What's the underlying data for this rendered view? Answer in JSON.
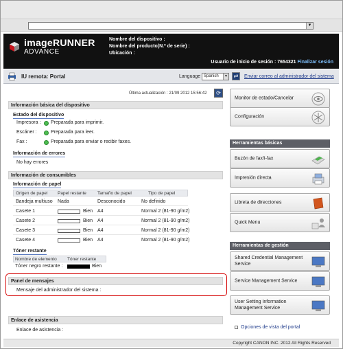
{
  "browser": {
    "url_value": ""
  },
  "header": {
    "logo_line1": "imageRUNNER",
    "logo_line2": "ADVANCE",
    "device_name_label": "Nombre del dispositivo :",
    "product_name_label": "Nombre del producto(N.º de serie) :",
    "location_label": "Ubicación :",
    "session_label": "Usuario de inicio de sesión : 7654321",
    "logout_link": "Finalizar sesión"
  },
  "portal_bar": {
    "title": "IU remota: Portal",
    "language_label": "Language",
    "language_value": "Spanish",
    "mail_link": "Enviar correo al administrador del sistema"
  },
  "status": {
    "last_update": "Última actualización : 21/09 2012 15:56:42"
  },
  "device_info": {
    "heading": "Información básica del dispositivo",
    "status_heading": "Estado del dispositivo",
    "items": [
      {
        "label": "Impresora :",
        "value": "Preparada para imprimir."
      },
      {
        "label": "Escáner :",
        "value": "Preparada para leer."
      },
      {
        "label": "Fax :",
        "value": "Preparada para enviar o recibir faxes."
      }
    ],
    "errors_heading": "Información de errores",
    "errors_value": "No hay errores"
  },
  "consumables": {
    "heading": "Información de consumibles",
    "paper_heading": "Información de papel",
    "paper_columns": [
      "Origen de papel",
      "Papel restante",
      "Tamaño de papel",
      "Tipo de papel"
    ],
    "paper_rows": [
      {
        "source": "Bandeja multiuso",
        "remaining": "Nada",
        "size": "Desconocido",
        "type": "No definido",
        "bar": false
      },
      {
        "source": "Casete 1",
        "remaining": "Bien",
        "size": "A4",
        "type": "Normal 2 (81-90 g/m2)",
        "bar": true
      },
      {
        "source": "Casete 2",
        "remaining": "Bien",
        "size": "A4",
        "type": "Normal 2 (81-90 g/m2)",
        "bar": true
      },
      {
        "source": "Casete 3",
        "remaining": "Bien",
        "size": "A4",
        "type": "Normal 2 (81-90 g/m2)",
        "bar": true
      },
      {
        "source": "Casete 4",
        "remaining": "Bien",
        "size": "A4",
        "type": "Normal 2 (81-90 g/m2)",
        "bar": true
      }
    ],
    "toner_heading": "Tóner restante",
    "toner_columns": [
      "Nombre de elemento",
      "Tóner restante"
    ],
    "toner_row": {
      "name": "Tóner negro restante :",
      "value": "Bien"
    }
  },
  "messages": {
    "heading": "Panel de mensajes",
    "admin_message": "Mensaje del administrador del sistema :"
  },
  "assistance": {
    "heading": "Enlace de asistencia",
    "value": "Enlace de asistencia :"
  },
  "sidebar": {
    "top_buttons": [
      {
        "label": "Monitor de estado/Cancelar"
      },
      {
        "label": "Configuración"
      }
    ],
    "basic_heading": "Herramientas básicas",
    "basic_buttons": [
      {
        "label": "Buzón de fax/I-fax"
      },
      {
        "label": "Impresión directa"
      },
      {
        "label": "Libreta de direcciones"
      },
      {
        "label": "Quick Menu"
      }
    ],
    "mgmt_heading": "Herramientas de gestión",
    "mgmt_buttons": [
      {
        "label": "Shared Credential Management Service"
      },
      {
        "label": "Service Management Service"
      },
      {
        "label": "User Setting Information Management Service"
      }
    ],
    "view_options": "Opciones de vista del portal"
  },
  "footer": {
    "copyright": "Copyright CANON INC. 2012 All Rights Reserved"
  }
}
